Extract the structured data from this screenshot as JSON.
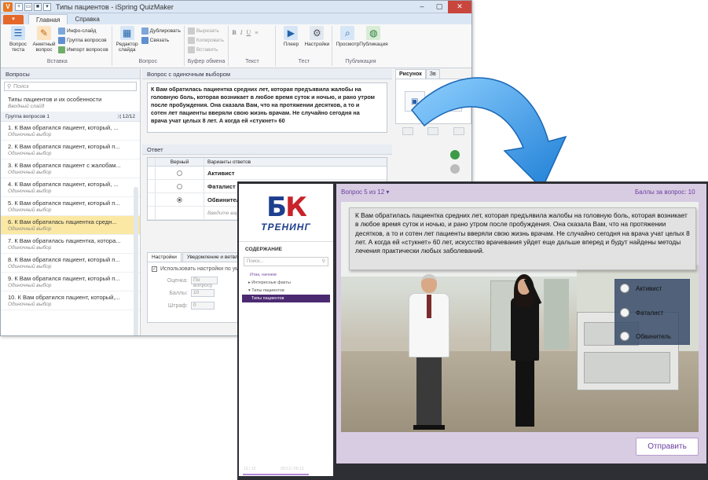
{
  "editor": {
    "window_title": "Типы пациентов - iSpring QuizMaker",
    "file_tab": "",
    "tabs": [
      "Главная",
      "Справка"
    ],
    "ribbon": {
      "insert": {
        "group": "Вставка",
        "graded_quiz": "Вопрос теста",
        "survey_question": "Анкетный вопрос",
        "info_slide": "Инфо-слайд",
        "question_group": "Группа вопросов",
        "import_questions": "Импорт вопросов"
      },
      "question": {
        "group": "Вопрос",
        "slide_editor": "Редактор слайда",
        "duplicate": "Дублировать",
        "link": "Связать"
      },
      "clipboard": {
        "group": "Буфер обмена",
        "cut": "Вырезать",
        "copy": "Копировать",
        "paste": "Вставить"
      },
      "text": {
        "group": "Текст",
        "bold": "B",
        "italic": "I",
        "underline": "U"
      },
      "test": {
        "group": "Тест",
        "player": "Плеер",
        "settings": "Настройки"
      },
      "publish": {
        "group": "Публикация",
        "preview": "Просмотр",
        "publish": "Публикация"
      }
    },
    "questions_panel": {
      "header": "Вопросы",
      "search_placeholder": "Поиск",
      "intro": {
        "title": "Типы пациентов и их особенности",
        "subtitle": "Вводный слайд"
      },
      "group": {
        "label": "Группа вопросов 1",
        "count": "12/12"
      },
      "items": [
        {
          "title": "1. К Вам обратился пациент, который, ...",
          "type": "Одиночный выбор"
        },
        {
          "title": "2. К Вам обратился пациент, который п...",
          "type": "Одиночный выбор"
        },
        {
          "title": "3. К Вам обратился пациент с жалобам...",
          "type": "Одиночный выбор"
        },
        {
          "title": "4. К Вам обратился пациент, который, ...",
          "type": "Одиночный выбор"
        },
        {
          "title": "5. К Вам обратился пациент, который п...",
          "type": "Одиночный выбор"
        },
        {
          "title": "6. К Вам обратилась пациентка средн...",
          "type": "Одиночный выбор"
        },
        {
          "title": "7. К Вам обратилась пациентка, котора...",
          "type": "Одиночный выбор"
        },
        {
          "title": "8. К Вам обратился пациент, который п...",
          "type": "Одиночный выбор"
        },
        {
          "title": "9. К Вам обратился пациент, который п...",
          "type": "Одиночный выбор"
        },
        {
          "title": "10. К Вам обратился пациент, который,...",
          "type": "Одиночный выбор"
        }
      ]
    },
    "question_panel": {
      "header": "Вопрос с одиночным выбором",
      "text": "К Вам обратилась пациентка средних лет, которая предъявила жалобы на головную боль, которая возникает в любое время суток и ночью, и рано утром после пробуждения. Она сказала Вам, что на протяжении десятков, а то и сотен лет пациенты вверяли свою жизнь врачам. Не случайно сегодня на врача учат целых 8 лет. А когда ей «стукнет» 60"
    },
    "answer_panel": {
      "header": "Ответ",
      "col_correct": "Верный",
      "col_answers": "Варианты ответов",
      "rows": [
        {
          "text": "Активист",
          "correct": false
        },
        {
          "text": "Фаталист",
          "correct": false
        },
        {
          "text": "Обвинитель",
          "correct": true
        }
      ],
      "placeholder": "Введите вари"
    },
    "settings_panel": {
      "tabs": [
        "Настройки",
        "Уведомление и ветвл"
      ],
      "use_settings": "Использовать настройки по умо",
      "score_label": "Оценка:",
      "score_value": "По вопросу",
      "points_label": "Баллы:",
      "points_value": "10",
      "penalty_label": "Штраф:",
      "penalty_value": "0"
    },
    "media_panel": {
      "tabs": [
        "Рисунок",
        "Зв"
      ]
    }
  },
  "player": {
    "logo_text": "ТРЕНИНГ",
    "toc_header": "СОДЕРЖАНИЕ",
    "toc_search_placeholder": "Поиск...",
    "toc_items": [
      "Итак, начнем",
      "Интересные факты",
      "Типы пациентов",
      "Типы пациентов"
    ],
    "question_counter": "Вопрос 5 из 12",
    "score_label": "Баллы за вопрос: 10",
    "question_text": "К Вам обратилась пациентка средних лет, которая предъявила жалобы на головную боль, которая возникает в любое время суток и ночью, и рано утром после пробуждения. Она сказала Вам, что на протяжении десятков, а то и сотен лет пациенты вверяли свою жизнь врачам. Не случайно сегодня на врача учат целых 8 лет. А когда ей «стукнет» 60 лет, искусство врачевания уйдет еще дальше вперед и будут найдены методы лечения практически любых заболеваний.",
    "options": [
      "Активист",
      "Фаталист",
      "Обвинитель"
    ],
    "submit_label": "Отправить",
    "slide_counter": "13 / 13",
    "time": "00:13 / 00:13"
  },
  "colors": {
    "player_accent": "#6b3fa0",
    "player_bg": "#2e2e35",
    "content_bg": "#d8cce2",
    "arrow": "#2f8fe0",
    "selected_item": "#fbe8a4",
    "close_button": "#c9463d"
  }
}
